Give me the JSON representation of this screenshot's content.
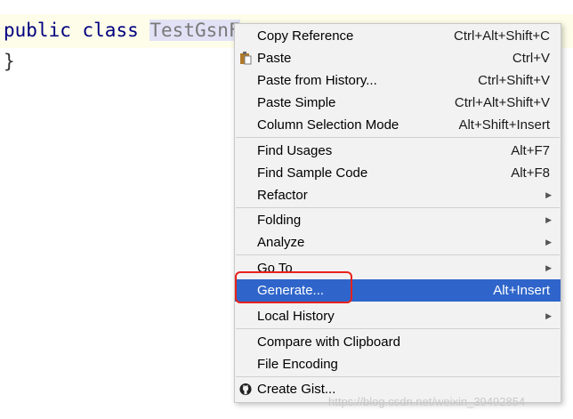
{
  "code": {
    "line1_keyword1": "public",
    "line1_keyword2": "class",
    "line1_classname": "TestGsnF",
    "line2": "}"
  },
  "menu": {
    "copy_reference": {
      "label": "Copy Reference",
      "shortcut": "Ctrl+Alt+Shift+C"
    },
    "paste": {
      "label": "Paste",
      "shortcut": "Ctrl+V"
    },
    "paste_history": {
      "label": "Paste from History...",
      "shortcut": "Ctrl+Shift+V"
    },
    "paste_simple": {
      "label": "Paste Simple",
      "shortcut": "Ctrl+Alt+Shift+V"
    },
    "column_selection": {
      "label": "Column Selection Mode",
      "shortcut": "Alt+Shift+Insert"
    },
    "find_usages": {
      "label": "Find Usages",
      "shortcut": "Alt+F7"
    },
    "find_sample": {
      "label": "Find Sample Code",
      "shortcut": "Alt+F8"
    },
    "refactor": {
      "label": "Refactor"
    },
    "folding": {
      "label": "Folding"
    },
    "analyze": {
      "label": "Analyze"
    },
    "goto": {
      "label": "Go To"
    },
    "generate": {
      "label": "Generate...",
      "shortcut": "Alt+Insert"
    },
    "local_history": {
      "label": "Local History"
    },
    "compare_clipboard": {
      "label": "Compare with Clipboard"
    },
    "file_encoding": {
      "label": "File Encoding"
    },
    "create_gist": {
      "label": "Create Gist..."
    }
  },
  "icons": {
    "paste": "clipboard-icon",
    "gist": "github-icon",
    "submenu": "triangle-right-icon"
  },
  "colors": {
    "selection": "#2f65ca",
    "highlight_box": "#e8221c",
    "menu_bg": "#f2f2f2"
  },
  "watermark": "https://blog.csdn.net/weixin_39492854"
}
